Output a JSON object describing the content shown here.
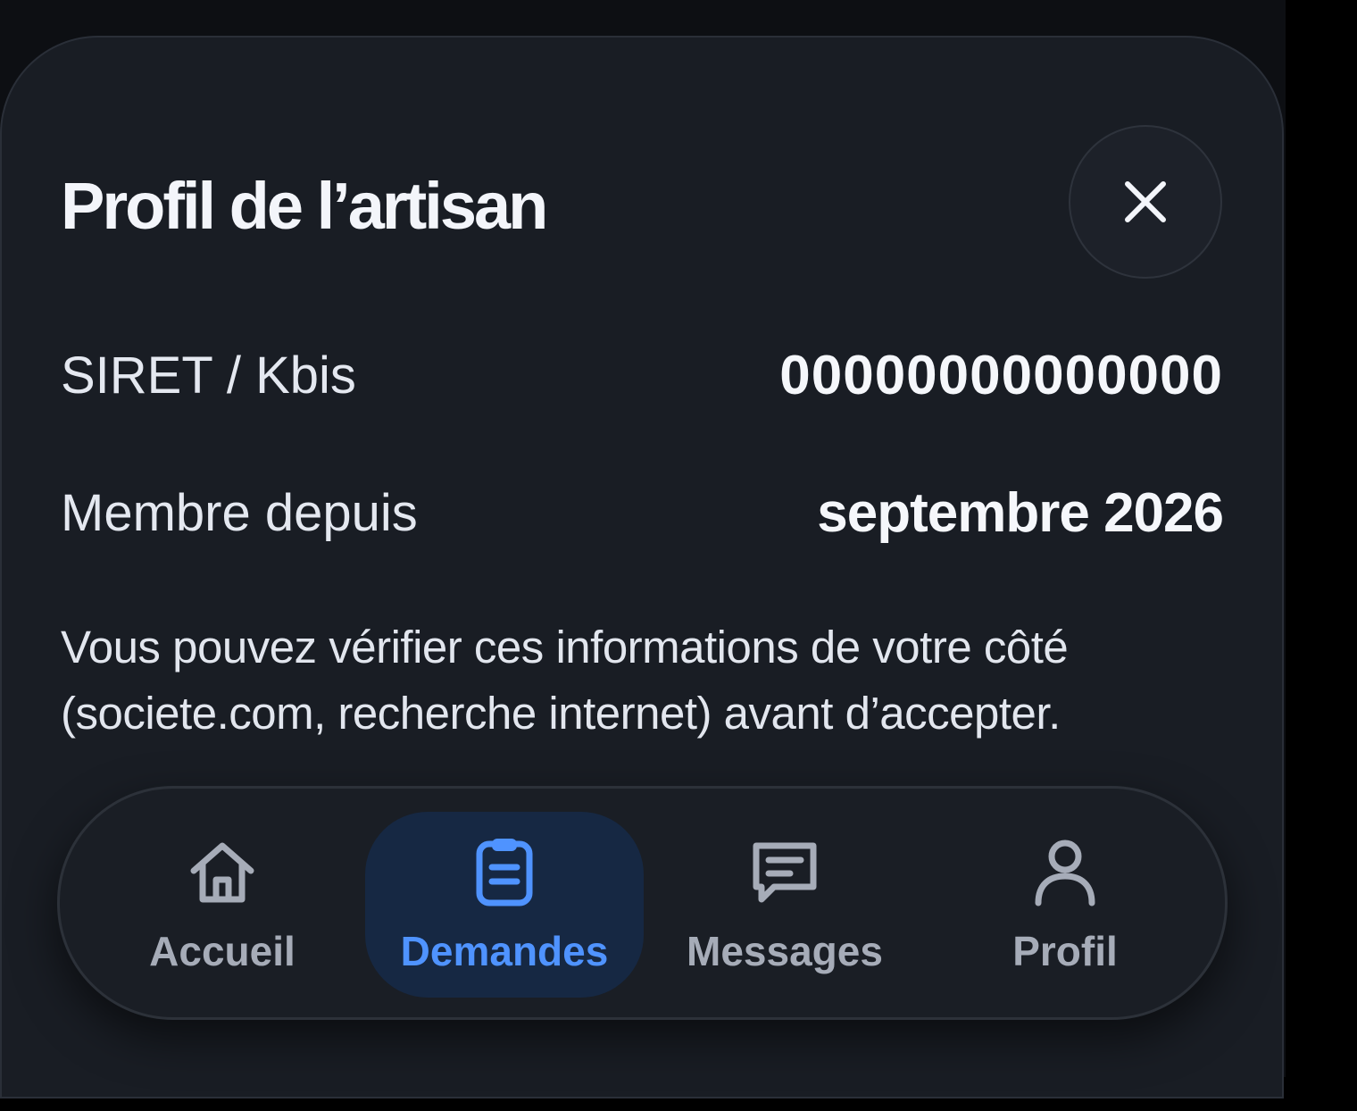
{
  "sheet": {
    "title": "Profil de l’artisan",
    "close_icon": "close-icon"
  },
  "details": {
    "siret_label": "SIRET / Kbis",
    "siret_value": "00000000000000",
    "member_since_label": "Membre depuis",
    "member_since_value": "septembre 2026"
  },
  "note": "Vous pouvez vérifier ces informations de votre côté (societe.com, recherche internet) avant d’accepter.",
  "bottom_nav": {
    "active": "Demandes",
    "items": [
      {
        "label": "Accueil",
        "icon": "home-icon"
      },
      {
        "label": "Demandes",
        "icon": "clipboard-icon"
      },
      {
        "label": "Messages",
        "icon": "message-icon"
      },
      {
        "label": "Profil",
        "icon": "user-icon"
      }
    ]
  },
  "colors": {
    "background": "#191d24",
    "accent": "#4f93ff",
    "active_tab_bg": "#162843",
    "inactive_text": "#a6acb8",
    "primary_text": "#f3f5fa"
  }
}
